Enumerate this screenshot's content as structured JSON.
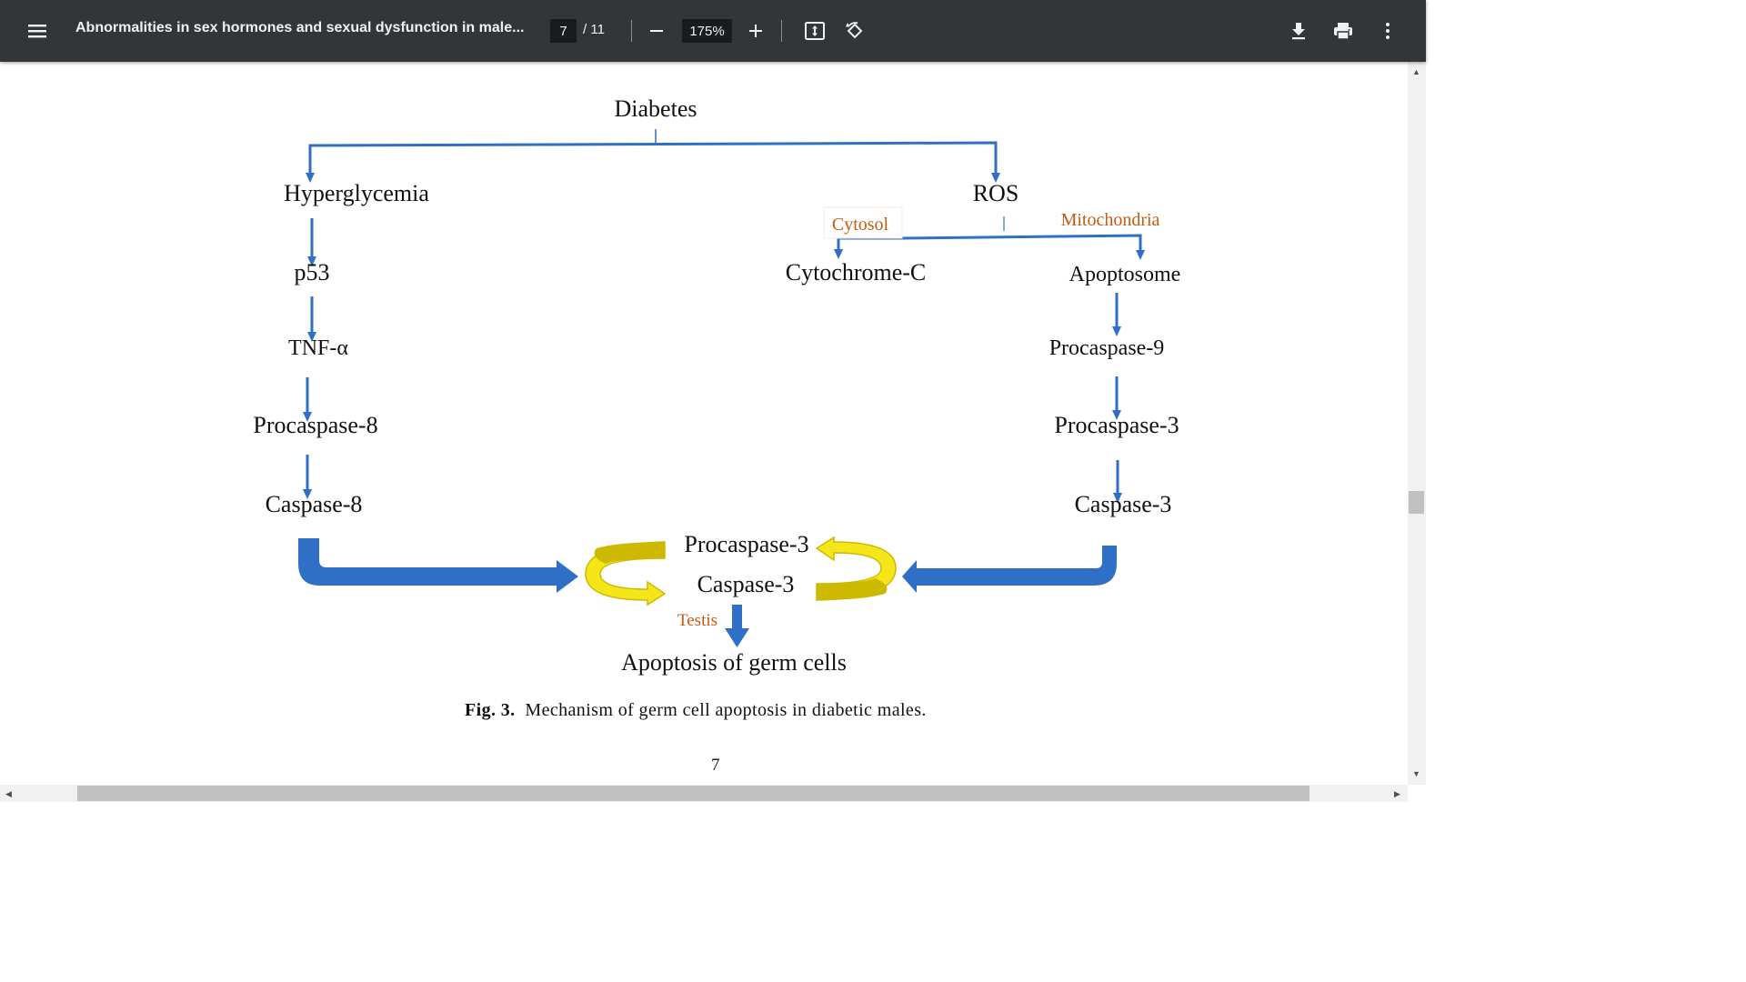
{
  "toolbar": {
    "title": "Abnormalities in sex hormones and sexual dysfunction in male...",
    "current_page": "7",
    "total_pages": "/ 11",
    "zoom": "175%",
    "icons": [
      "menu-icon",
      "zoom-out-icon",
      "zoom-in-icon",
      "fit-page-icon",
      "rotate-icon",
      "download-icon",
      "print-icon",
      "more-options-icon"
    ]
  },
  "diagram": {
    "nodes": {
      "diabetes": "Diabetes",
      "hyperglycemia": "Hyperglycemia",
      "ros": "ROS",
      "cytosol": "Cytosol",
      "mitochondria": "Mitochondria",
      "p53": "p53",
      "cytochrome_c": "Cytochrome-C",
      "apoptosome": "Apoptosome",
      "tnf_alpha": "TNF-α",
      "procaspase_9": "Procaspase-9",
      "procaspase_8": "Procaspase-8",
      "procaspase_3_right": "Procaspase-3",
      "caspase_8": "Caspase-8",
      "caspase_3_right": "Caspase-3",
      "procaspase_3_center": "Procaspase-3",
      "caspase_3_center": "Caspase-3",
      "testis": "Testis",
      "apoptosis": "Apoptosis of germ cells"
    },
    "colors": {
      "arrow_blue": "#2f6fc6",
      "cycle_yellow": "#f5e61a",
      "cycle_olive": "#cdb900",
      "label_orange": "#c55a11",
      "text": "#111111"
    }
  },
  "caption": {
    "label": "Fig. 3.",
    "text": "Mechanism of germ cell apoptosis in diabetic males."
  },
  "page_number": "7"
}
